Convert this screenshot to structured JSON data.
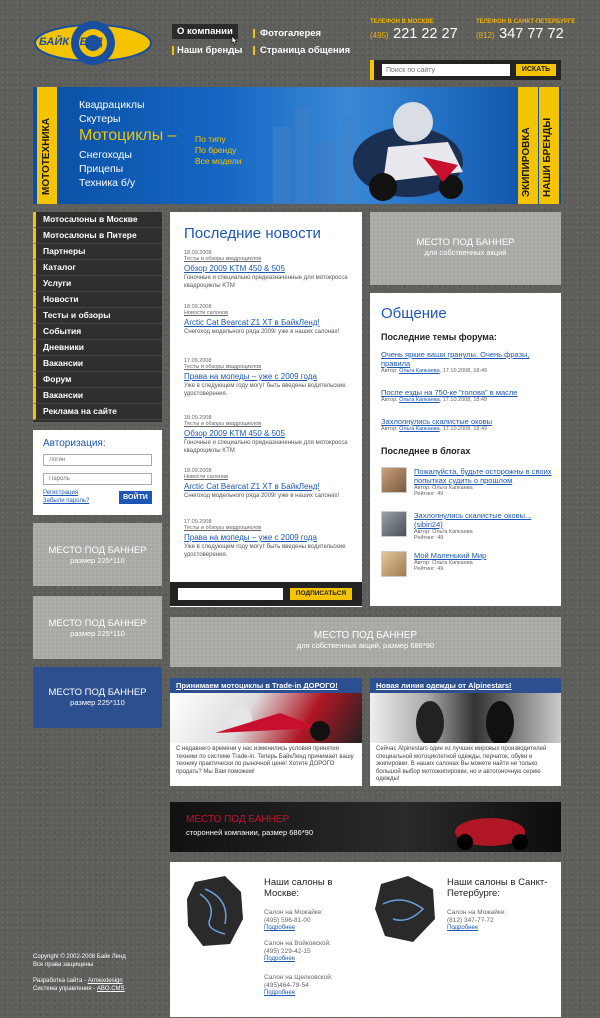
{
  "header": {
    "logo_text": "БАЙК ЛЕНД",
    "nav": [
      "О компании",
      "Фотогалерея",
      "Наши бренды",
      "Страница общения"
    ],
    "phones": [
      {
        "label": "ТЕЛЕФОН В МОСКВЕ",
        "code": "(495)",
        "number": "221 22 27"
      },
      {
        "label": "ТЕЛЕФОН В САНКТ-ПЕТЕРБУРГЕ",
        "code": "(812)",
        "number": "347 77 72"
      }
    ],
    "search": {
      "placeholder": "Поиск по сайту",
      "button": "ИСКАТЬ"
    }
  },
  "banner": {
    "left_vertical": "МОТОТЕХНИКА",
    "right_vertical": [
      "ЭКИПИРОВКА",
      "НАШИ БРЕНДЫ"
    ],
    "categories": [
      "Квадрациклы",
      "Скутеры",
      "Мотоциклы –",
      "Снегоходы",
      "Прицепы",
      "Техника б/у"
    ],
    "sub": [
      "По типу",
      "По бренду",
      "Все модели"
    ]
  },
  "menu": [
    "Мотосалоны в Москве",
    "Мотосалоны в Питере",
    "Партнеры",
    "Каталог",
    "Услуги",
    "Новости",
    "Тесты и обзоры",
    "События",
    "Дневники",
    "Вакансии",
    "Форум",
    "Вакансии",
    "Реклама на сайте"
  ],
  "auth": {
    "title": "Авторизация:",
    "login_placeholder": "Логин",
    "password_placeholder": "Пароль",
    "register": "Регистрация",
    "forgot": "Забыли пароль?",
    "button": "ВОЙТИ"
  },
  "left_banners": [
    {
      "main": "МЕСТО ПОД БАННЕР",
      "sub": "размер 225*110"
    },
    {
      "main": "МЕСТО ПОД БАННЕР",
      "sub": "размер 225*110"
    },
    {
      "main": "МЕСТО ПОД БАННЕР",
      "sub": "размер 225*110"
    }
  ],
  "news": {
    "title": "Последние новости",
    "items": [
      {
        "date": "18.09.2008",
        "cat": "Тесты и обзоры квадроциклов",
        "title": "Обзор 2009 KTM 450 & 505",
        "text": "Гоночные и специально предназначенные для мотокросса квадроциклы KTM"
      },
      {
        "date": "18.09.2008",
        "cat": "Новости салонов",
        "title": "Arctic Cat Bearcat Z1 XT в БайкЛенд!",
        "text": "Снегоход модельного ряда 2009г уже в наших салонах!"
      },
      {
        "date": "17.09.2008",
        "cat": "Тесты и обзоры квадроциклов",
        "title": "Права на мопеды – уже с 2009 года",
        "text": "Уже в следующем году могут быть введены водительские удостоверения."
      },
      {
        "date": "18.09.2008",
        "cat": "Тесты и обзоры квадроциклов",
        "title": "Обзор 2009 KTM 450 & 505",
        "text": "Гоночные и специально предназначенные для мотокросса квадроциклы KTM"
      },
      {
        "date": "18.09.2008",
        "cat": "Новости салонов",
        "title": "Arctic Cat Bearcat Z1 XT в БайкЛенд!",
        "text": "Снегоход модельного ряда 2009г уже в наших салонах!"
      },
      {
        "date": "17.09.2008",
        "cat": "Тесты и обзоры квадроциклов",
        "title": "Права на мопеды – уже с 2009 года",
        "text": "Уже в следующем году могут быть введены водительские удостоверения."
      }
    ],
    "subscribe": "ПОДПИСАТЬСЯ"
  },
  "right_banner": {
    "main": "МЕСТО ПОД БАННЕР",
    "sub": "для собственных акций"
  },
  "forum": {
    "title": "Общение",
    "topics_heading": "Последние темы форума:",
    "topics": [
      {
        "title": "Очень яркие ваши гранулы. Очень фразы, правила",
        "author": "Ольга Капкаева",
        "date": "17.10.2008, 18:49"
      },
      {
        "title": "После езды на 750-ке \"голова\" в масле",
        "author": "Ольга Капкаева",
        "date": "17.10.2008, 18:49"
      },
      {
        "title": "Захлопнулись скалистые оковы",
        "author": "Ольга Капкаева",
        "date": "17.10.2008, 18:49"
      }
    ],
    "blogs_heading": "Последнее в блогах",
    "blogs": [
      {
        "title": "Пожалуйста, будьте осторожны в своих попытках судить о прошлом",
        "author": "Ольга Капкаева",
        "rating": "49"
      },
      {
        "title": "Захлопнулись скалистые оковы... (sibiri24)",
        "author": "Ольга Капкаева",
        "rating": "49"
      },
      {
        "title": "Мой Маленький Мир",
        "author": "Ольга Капкаева",
        "rating": "49"
      }
    ]
  },
  "wide_banner": {
    "main": "МЕСТО ПОД БАННЕР",
    "sub": "для собственных акций, размер 686*90"
  },
  "promos": [
    {
      "title": "Принимаем мотоциклы в Trade-in ДОРОГО!",
      "text": "С недавнего времени у нас изменились условия принятия техники по системе Trade-in. Теперь БайкЛенд принимает вашу технику практически по рыночной цене! Хотите ДОРОГО продать? Мы Вам поможем!"
    },
    {
      "title": "Новая линия одежды от Alpinestars!",
      "text": "Сейчас Alpinestars один из лучших мировых производителей специальной мотоциклетной одежды, перчаток, обуви и экипировки. В наших салонах Вы можете найти не только большой выбор мотоэкипировки, но и автогоночную серию одежды!"
    }
  ],
  "third_banner": {
    "main": "МЕСТО ПОД БАННЕР",
    "sub": "сторонней компании, размер 686*90"
  },
  "salons": {
    "moscow": {
      "heading": "Наши салоны в Москве:",
      "items": [
        {
          "name": "Салон на Можайке:",
          "phone": "(495) 596-81-00"
        },
        {
          "name": "Салон на Войковской:",
          "phone": "(495) 229-42-15"
        },
        {
          "name": "Салон на Щелковской:",
          "phone": "(495)464-79-54"
        }
      ]
    },
    "spb": {
      "heading": "Наши салоны в Санкт-Петербурге:",
      "items": [
        {
          "name": "Салон на Можайке:",
          "phone": "(812) 347-77-72"
        }
      ]
    },
    "more": "Подробнее"
  },
  "footer": {
    "copyright": "Copyright © 2002-2008 Байк Ленд",
    "rights": "Все права защищены",
    "dev_prefix": "Разработка сайта - ",
    "dev": "Armexdesign",
    "cms_prefix": "Система управления - ",
    "cms": "ABO.CMS"
  },
  "colors": {
    "accent": "#f5c400",
    "blue": "#1d57b4",
    "dark": "#2f2f2f"
  }
}
